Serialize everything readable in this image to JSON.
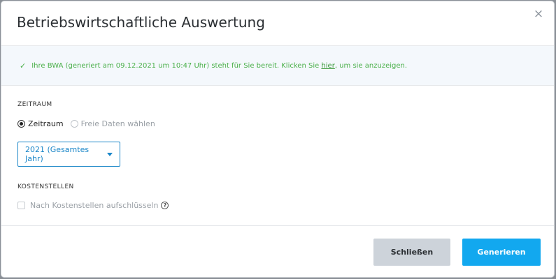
{
  "modal": {
    "title": "Betriebswirtschaftliche Auswertung",
    "close_symbol": "×"
  },
  "alert": {
    "icon": "check-icon",
    "text_before_link": "Ihre BWA (generiert am 09.12.2021 um 10:47 Uhr) steht für Sie bereit. Klicken Sie ",
    "link": "hier",
    "text_after_link": ", um sie anzuzeigen.",
    "color": "#4bb04b"
  },
  "zeitraum": {
    "label": "ZEITRAUM",
    "options": [
      {
        "label": "Zeitraum",
        "checked": true
      },
      {
        "label": "Freie Daten wählen",
        "checked": false
      }
    ],
    "select_value": "2021 (Gesamtes Jahr)"
  },
  "kostenstellen": {
    "label": "KOSTENSTELLEN",
    "checkbox_label": "Nach Kostenstellen aufschlüsseln",
    "checked": false,
    "help_icon": "?"
  },
  "footer": {
    "close_label": "Schließen",
    "generate_label": "Generieren",
    "accent_color": "#12a8ef"
  }
}
